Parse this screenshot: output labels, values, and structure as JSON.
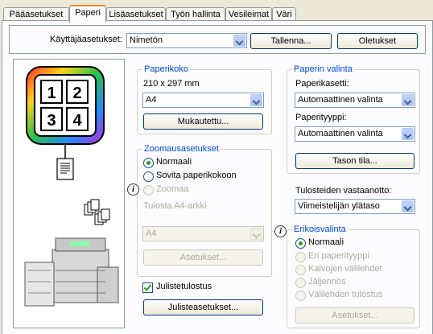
{
  "tabs": [
    {
      "label": "Pääasetukset"
    },
    {
      "label": "Paperi"
    },
    {
      "label": "Lisäasetukset"
    },
    {
      "label": "Työn hallinta"
    },
    {
      "label": "Vesileimat"
    },
    {
      "label": "Väri"
    }
  ],
  "user_settings": {
    "label": "Käyttäjäasetukset:",
    "value": "Nimetön",
    "save_label": "Tallenna...",
    "defaults_label": "Oletukset"
  },
  "preview": {
    "page_numbers": [
      "1",
      "2",
      "3",
      "4"
    ],
    "icon_names": [
      "nup-layout-icon",
      "document-icon",
      "sort-output-icon",
      "printer-machine-icon"
    ]
  },
  "paper_size": {
    "group_title": "Paperikoko",
    "dimensions": "210 x 297 mm",
    "value": "A4",
    "custom_label": "Mukautettu..."
  },
  "zoom": {
    "group_title": "Zoomausasetukset",
    "options": [
      "Normaali",
      "Sovita paperikokoon",
      "Zoomaa"
    ],
    "selected": "Normaali",
    "print_on_label": "Tulosta A4-arkki",
    "print_on_value": "A4",
    "settings_label": "Asetukset..."
  },
  "poster": {
    "checkbox_label": "Julistetulostus",
    "checked": true,
    "settings_label": "Julisteasetukset..."
  },
  "paper_selection": {
    "group_title": "Paperin valinta",
    "tray_label": "Paperikasetti:",
    "tray_value": "Automaattinen valinta",
    "type_label": "Paperityyppi:",
    "type_value": "Automaattinen valinta",
    "tray_status_label": "Tason tila..."
  },
  "output": {
    "label": "Tulosteiden vastaanotto:",
    "value": "Viimeistelijän ylätaso"
  },
  "special": {
    "group_title": "Erikoisvalinta",
    "options": [
      "Normaali",
      "Eri paperityyppi",
      "Kalvojen välilehdet",
      "Jäljennös",
      "Välilehden tulostus"
    ],
    "selected": "Normaali",
    "settings_label": "Asetukset..."
  },
  "colors": {
    "accent": "#0046d5",
    "tab_highlight": "#e68b2c",
    "dialog_bg": "#ece9d8"
  }
}
